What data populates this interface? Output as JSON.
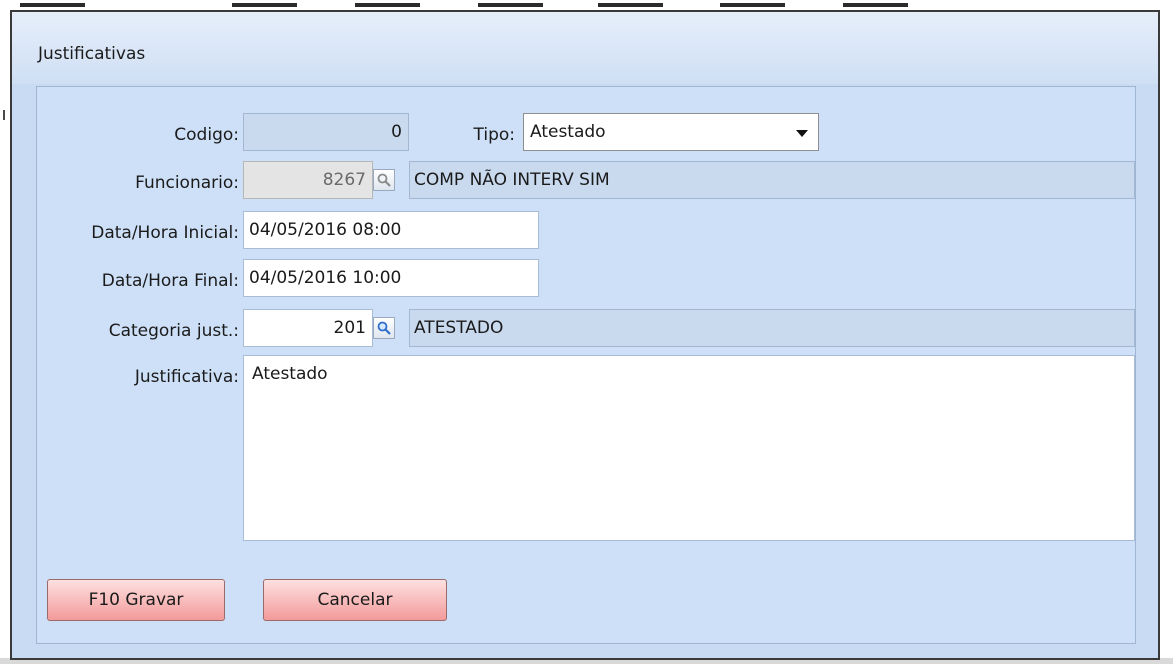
{
  "dialog": {
    "title": "Justificativas"
  },
  "form": {
    "codigo": {
      "label": "Codigo:",
      "value": "0"
    },
    "tipo": {
      "label": "Tipo:",
      "value": "Atestado"
    },
    "funcionario": {
      "label": "Funcionario:",
      "code": "8267",
      "name": "COMP NÃO INTERV SIM"
    },
    "data_inicial": {
      "label": "Data/Hora Inicial:",
      "value": "04/05/2016 08:00"
    },
    "data_final": {
      "label": "Data/Hora Final:",
      "value": "04/05/2016 10:00"
    },
    "categoria": {
      "label": "Categoria just.:",
      "code": "201",
      "name": "ATESTADO"
    },
    "justificativa": {
      "label": "Justificativa:",
      "value": "Atestado"
    }
  },
  "buttons": {
    "save_label": "F10 Gravar",
    "cancel_label": "Cancelar"
  },
  "icons": {
    "lookup": "magnifier-icon",
    "dropdown": "chevron-down-icon"
  },
  "colors": {
    "dialog_bg": "#cde0f7",
    "button_bg": "#f39a9a",
    "readonly_field": "#c9daef"
  }
}
